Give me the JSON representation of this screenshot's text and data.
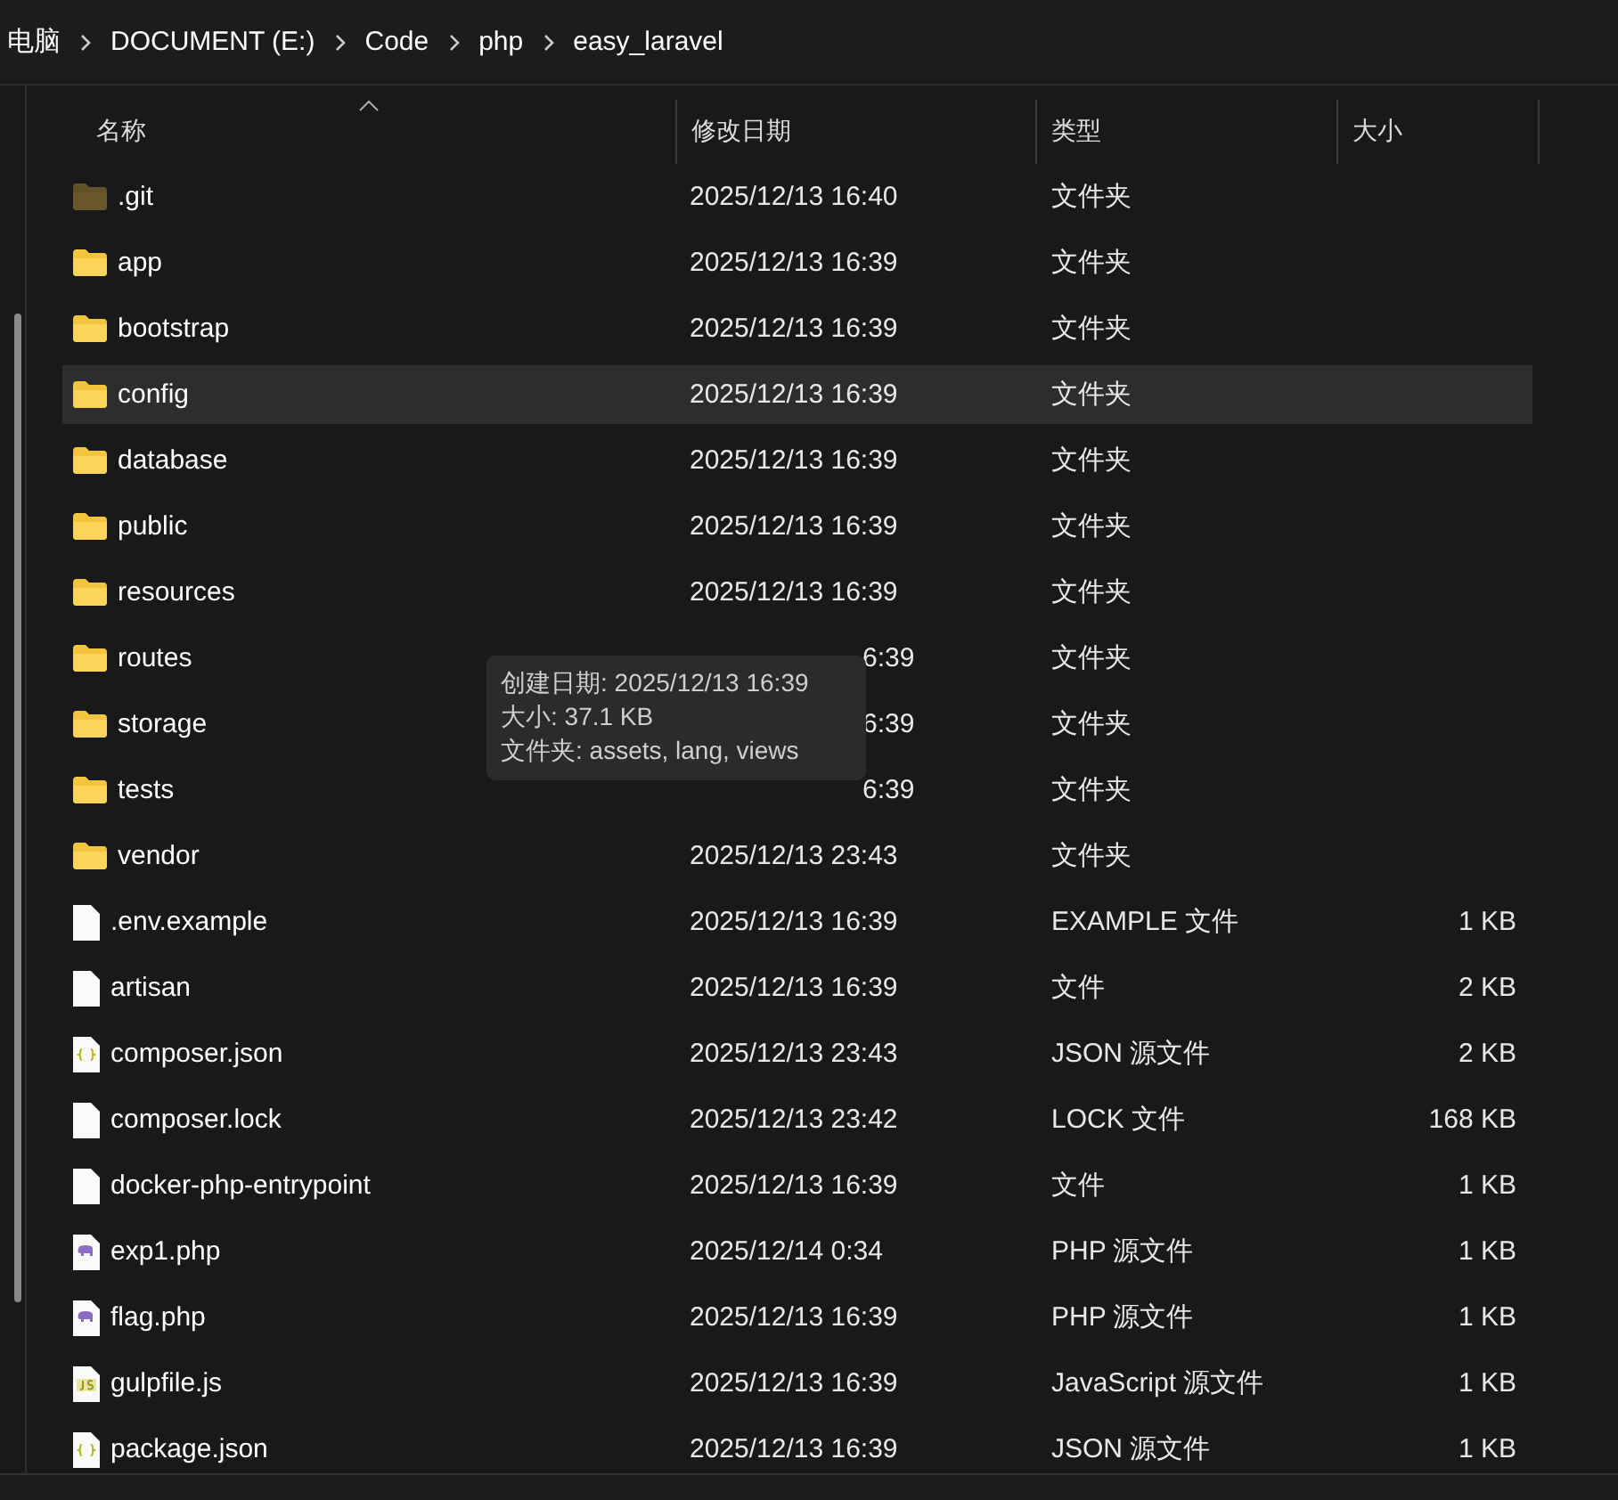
{
  "breadcrumb": [
    "电脑",
    "DOCUMENT (E:)",
    "Code",
    "php",
    "easy_laravel"
  ],
  "columns": [
    {
      "label": "名称",
      "sorted": true
    },
    {
      "label": "修改日期",
      "sorted": false
    },
    {
      "label": "类型",
      "sorted": false
    },
    {
      "label": "大小",
      "sorted": false
    }
  ],
  "rows": [
    {
      "name": ".git",
      "date": "2025/12/13 16:40",
      "type": "文件夹",
      "kind": "folder",
      "hidden": true,
      "selected": false
    },
    {
      "name": "app",
      "date": "2025/12/13 16:39",
      "type": "文件夹",
      "kind": "folder",
      "hidden": false,
      "selected": false
    },
    {
      "name": "bootstrap",
      "date": "2025/12/13 16:39",
      "type": "文件夹",
      "kind": "folder",
      "hidden": false,
      "selected": false
    },
    {
      "name": "config",
      "date": "2025/12/13 16:39",
      "type": "文件夹",
      "kind": "folder",
      "hidden": false,
      "selected": true
    },
    {
      "name": "database",
      "date": "2025/12/13 16:39",
      "type": "文件夹",
      "kind": "folder",
      "hidden": false,
      "selected": false
    },
    {
      "name": "public",
      "date": "2025/12/13 16:39",
      "type": "文件夹",
      "kind": "folder",
      "hidden": false,
      "selected": false
    },
    {
      "name": "resources",
      "date": "2025/12/13 16:39",
      "type": "文件夹",
      "kind": "folder",
      "hidden": false,
      "selected": false
    },
    {
      "name": "routes",
      "date": "6:39",
      "date_covered": true,
      "type": "文件夹",
      "kind": "folder",
      "hidden": false,
      "selected": false
    },
    {
      "name": "storage",
      "date": "6:39",
      "date_covered": true,
      "type": "文件夹",
      "kind": "folder",
      "hidden": false,
      "selected": false
    },
    {
      "name": "tests",
      "date": "6:39",
      "date_covered": true,
      "type": "文件夹",
      "kind": "folder",
      "hidden": false,
      "selected": false
    },
    {
      "name": "vendor",
      "date": "2025/12/13 23:43",
      "type": "文件夹",
      "kind": "folder",
      "hidden": false,
      "selected": false
    },
    {
      "name": ".env.example",
      "date": "2025/12/13 16:39",
      "type": "EXAMPLE 文件",
      "size": "1 KB",
      "kind": "file",
      "hidden": false,
      "selected": false
    },
    {
      "name": "artisan",
      "date": "2025/12/13 16:39",
      "type": "文件",
      "size": "2 KB",
      "kind": "file",
      "hidden": false,
      "selected": false
    },
    {
      "name": "composer.json",
      "date": "2025/12/13 23:43",
      "type": "JSON 源文件",
      "size": "2 KB",
      "kind": "json",
      "hidden": false,
      "selected": false
    },
    {
      "name": "composer.lock",
      "date": "2025/12/13 23:42",
      "type": "LOCK 文件",
      "size": "168 KB",
      "kind": "file",
      "hidden": false,
      "selected": false
    },
    {
      "name": "docker-php-entrypoint",
      "date": "2025/12/13 16:39",
      "type": "文件",
      "size": "1 KB",
      "kind": "file",
      "hidden": false,
      "selected": false
    },
    {
      "name": "exp1.php",
      "date": "2025/12/14 0:34",
      "type": "PHP 源文件",
      "size": "1 KB",
      "kind": "php",
      "hidden": false,
      "selected": false
    },
    {
      "name": "flag.php",
      "date": "2025/12/13 16:39",
      "type": "PHP 源文件",
      "size": "1 KB",
      "kind": "php",
      "hidden": false,
      "selected": false
    },
    {
      "name": "gulpfile.js",
      "date": "2025/12/13 16:39",
      "type": "JavaScript 源文件",
      "size": "1 KB",
      "kind": "js",
      "hidden": false,
      "selected": false
    },
    {
      "name": "package.json",
      "date": "2025/12/13 16:39",
      "type": "JSON 源文件",
      "size": "1 KB",
      "kind": "json",
      "hidden": false,
      "selected": false
    }
  ],
  "tooltip": {
    "lines": [
      "创建日期: 2025/12/13 16:39",
      "大小: 37.1 KB",
      "文件夹: assets, lang, views"
    ]
  }
}
